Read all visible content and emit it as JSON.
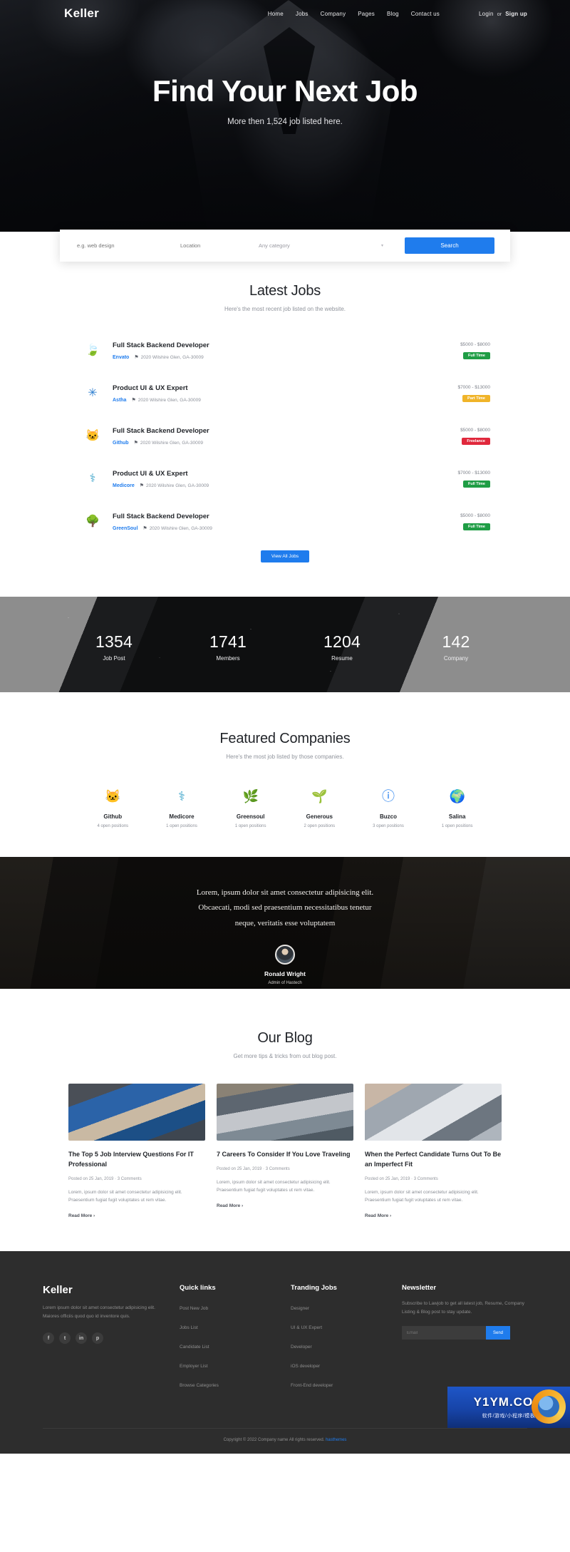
{
  "nav": {
    "brand": "Keller",
    "links": [
      "Home",
      "Jobs",
      "Company",
      "Pages",
      "Blog",
      "Contact us"
    ],
    "login": "Login",
    "or": "or",
    "signup": "Sign up"
  },
  "hero": {
    "title": "Find Your Next Job",
    "subtitle": "More then 1,524 job listed here."
  },
  "search": {
    "keyword_placeholder": "e.g. web design",
    "location_placeholder": "Location",
    "category_value": "Any category",
    "caret": "▾",
    "button": "Search"
  },
  "latest": {
    "title": "Latest Jobs",
    "subtitle": "Here's the most recent job listed on the website.",
    "view_all": "View All Jobs",
    "pin_icon": "⚑",
    "jobs": [
      {
        "logo_icon": "leaf-logo",
        "glyph": "🍃",
        "title": "Full Stack Backend Developer",
        "company": "Envato",
        "location": "2020 Wilshire Glen, GA-30009",
        "salary": "$5000 - $8000",
        "type": "Full Time",
        "type_class": "badge-full"
      },
      {
        "logo_icon": "astha-logo",
        "glyph": "✳",
        "title": "Product UI & UX Expert",
        "company": "Astha",
        "location": "2020 Wilshire Glen, GA-30009",
        "salary": "$7000 - $13000",
        "type": "Part Time",
        "type_class": "badge-part"
      },
      {
        "logo_icon": "github-logo",
        "glyph": "🐱",
        "title": "Full Stack Backend Developer",
        "company": "Github",
        "location": "2020 Wilshire Glen, GA-30009",
        "salary": "$5000 - $8000",
        "type": "Freelance",
        "type_class": "badge-free"
      },
      {
        "logo_icon": "medicore-logo",
        "glyph": "⚕",
        "title": "Product UI & UX Expert",
        "company": "Medicore",
        "location": "2020 Wilshire Glen, GA-30009",
        "salary": "$7000 - $13000",
        "type": "Full Time",
        "type_class": "badge-full"
      },
      {
        "logo_icon": "greensoul-logo",
        "glyph": "🌳",
        "title": "Full Stack Backend Developer",
        "company": "GreenSoul",
        "location": "2020 Wilshire Glen, GA-30009",
        "salary": "$5000 - $8000",
        "type": "Full Time",
        "type_class": "badge-full"
      }
    ]
  },
  "stats": [
    {
      "number": "1354",
      "label": "Job Post"
    },
    {
      "number": "1741",
      "label": "Members"
    },
    {
      "number": "1204",
      "label": "Resume"
    },
    {
      "number": "142",
      "label": "Company"
    }
  ],
  "featured": {
    "title": "Featured Companies",
    "subtitle": "Here's the most job listed by those companies.",
    "companies": [
      {
        "logo_icon": "github-logo",
        "glyph": "🐱",
        "name": "Github",
        "open": "4 open positions"
      },
      {
        "logo_icon": "medicore-logo",
        "glyph": "⚕",
        "name": "Medicore",
        "open": "1 open positions"
      },
      {
        "logo_icon": "greensoul-logo",
        "glyph": "🌿",
        "name": "Greensoul",
        "open": "1 open positions"
      },
      {
        "logo_icon": "generous-logo",
        "glyph": "🌱",
        "name": "Generous",
        "open": "2 open positions"
      },
      {
        "logo_icon": "buzco-logo",
        "glyph": "ⓘ",
        "name": "Buzco",
        "open": "3 open positions"
      },
      {
        "logo_icon": "salina-logo",
        "glyph": "🌍",
        "name": "Salina",
        "open": "1 open positions"
      }
    ]
  },
  "testimonial": {
    "line1": "Lorem, ipsum dolor sit amet consectetur adipisicing elit.",
    "line2": "Obcaecati, modi sed praesentium necessitatibus tenetur",
    "line3": "neque, veritatis esse voluptatem",
    "name": "Ronald Wright",
    "role": "Admin of Hastech"
  },
  "blog": {
    "title": "Our Blog",
    "subtitle": "Get more tips & tricks from out blog post.",
    "posts": [
      {
        "img_class": "a",
        "title": "The Top 5 Job Interview Questions For IT Professional",
        "meta": "Posted on 25 Jan, 2019  ·  3 Comments",
        "text": "Lorem, ipsum dolor sit amet consectetur adipisicing elit. Praesentium fugiat fugit voluptates ut rem vitae.",
        "more": "Read More  ›"
      },
      {
        "img_class": "b",
        "title": "7 Careers To Consider If You Love Traveling",
        "meta": "Posted on 25 Jan, 2019  ·  3 Comments",
        "text": "Lorem, ipsum dolor sit amet consectetur adipisicing elit. Praesentium fugiat fugit voluptates ut rem vitae.",
        "more": "Read More  ›"
      },
      {
        "img_class": "c",
        "title": "When the Perfect Candidate Turns Out To Be an Imperfect Fit",
        "meta": "Posted on 25 Jan, 2019  ·  3 Comments",
        "text": "Lorem, ipsum dolor sit amet consectetur adipisicing elit. Praesentium fugiat fugit voluptates ut rem vitae.",
        "more": "Read More  ›"
      }
    ]
  },
  "footer": {
    "brand": "Keller",
    "about": "Lorem ipsum dolor sit amet consectetur adipisicing elit. Maiores officiis quod quo id inventore quis.",
    "socials": [
      {
        "icon": "facebook-icon",
        "glyph": "f"
      },
      {
        "icon": "twitter-icon",
        "glyph": "t"
      },
      {
        "icon": "linkedin-icon",
        "glyph": "in"
      },
      {
        "icon": "pinterest-icon",
        "glyph": "p"
      }
    ],
    "quick_links_title": "Quick links",
    "quick_links": [
      "Post New Job",
      "Jobs List",
      "Candidate List",
      "Employer List",
      "Browse Categories"
    ],
    "trending_title": "Tranding Jobs",
    "trending": [
      "Designer",
      "UI & UX Expert",
      "Developer",
      "iOS developer",
      "Front-End developer"
    ],
    "newsletter_title": "Newsletter",
    "newsletter_text": "Subscribe to Lawjob to get all latest job, Resume, Company Listing & Blog post to stay update.",
    "newsletter_placeholder": "Email",
    "newsletter_button": "Send",
    "copyright": "Copyright © 2022 Company name All rights reserved.",
    "copyright_link": "hasthemes"
  },
  "watermark": {
    "title": "Y1YM.COM",
    "subtitle": "软件/游戏/小程序/模板"
  },
  "colors": {
    "accent": "#1f7ced",
    "full_time": "#1f9d45",
    "part_time": "#f0b429",
    "freelance": "#e0283c",
    "footer_bg": "#2d2d2d"
  }
}
